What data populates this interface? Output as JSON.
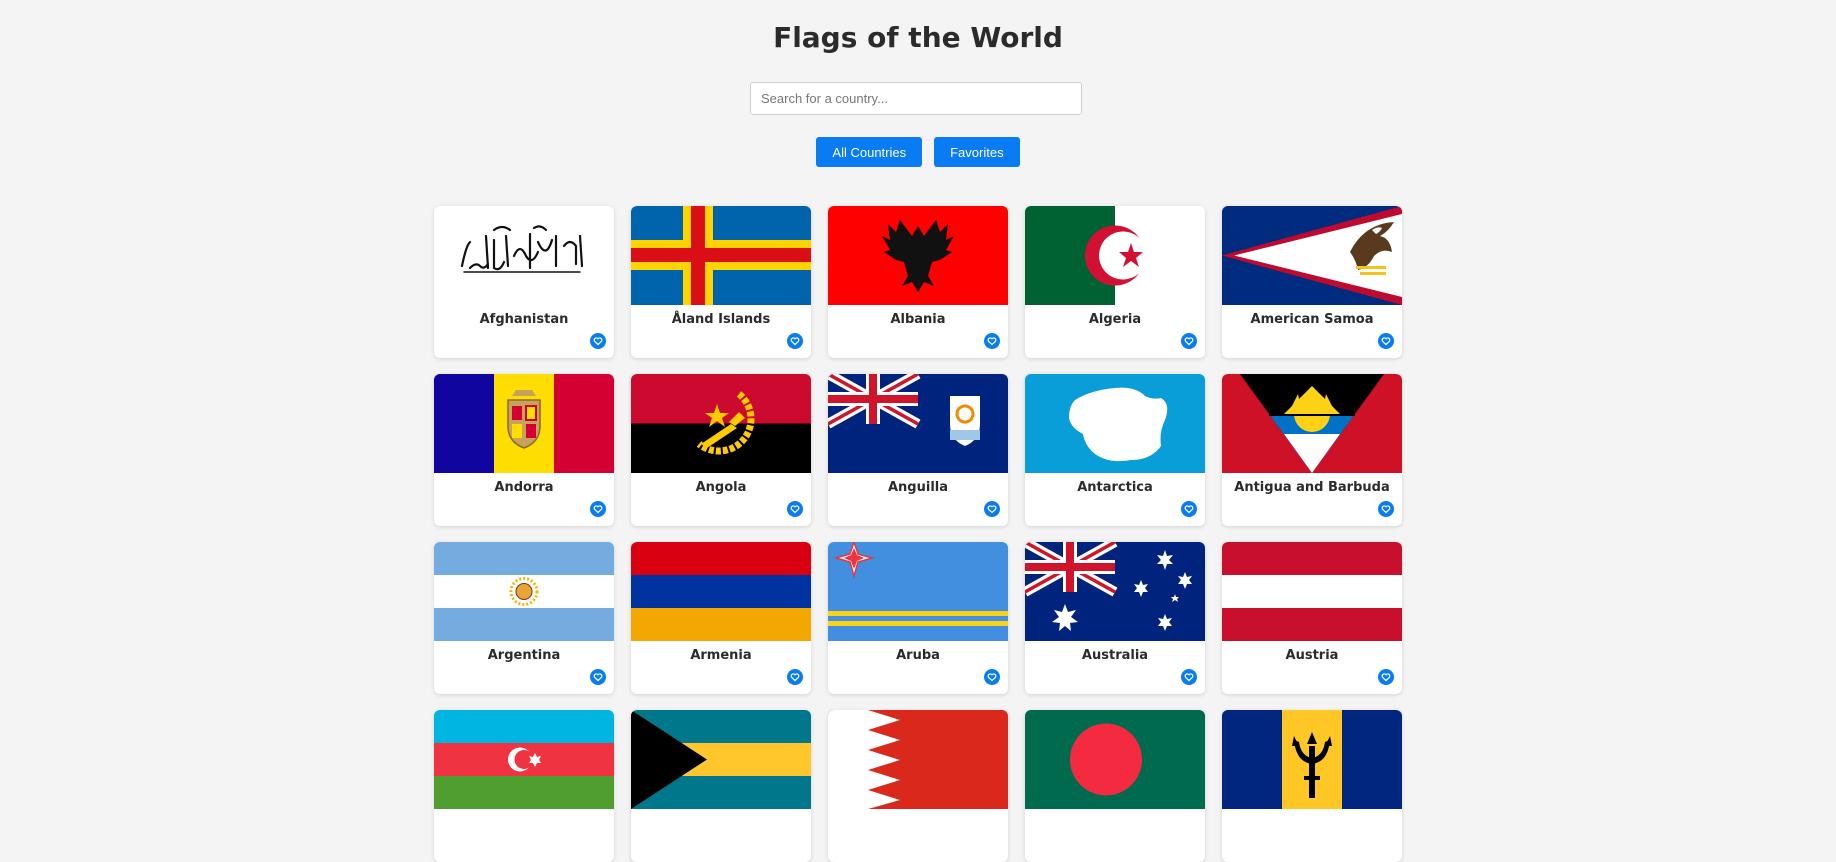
{
  "header": {
    "title": "Flags of the World"
  },
  "search": {
    "placeholder": "Search for a country..."
  },
  "tabs": [
    {
      "label": "All Countries"
    },
    {
      "label": "Favorites"
    }
  ],
  "countries": [
    {
      "name": "Afghanistan",
      "flag": "afghanistan-flag"
    },
    {
      "name": "Åland Islands",
      "flag": "aland-islands-flag"
    },
    {
      "name": "Albania",
      "flag": "albania-flag"
    },
    {
      "name": "Algeria",
      "flag": "algeria-flag"
    },
    {
      "name": "American Samoa",
      "flag": "american-samoa-flag"
    },
    {
      "name": "Andorra",
      "flag": "andorra-flag"
    },
    {
      "name": "Angola",
      "flag": "angola-flag"
    },
    {
      "name": "Anguilla",
      "flag": "anguilla-flag"
    },
    {
      "name": "Antarctica",
      "flag": "antarctica-flag"
    },
    {
      "name": "Antigua and Barbuda",
      "flag": "antigua-and-barbuda-flag"
    },
    {
      "name": "Argentina",
      "flag": "argentina-flag"
    },
    {
      "name": "Armenia",
      "flag": "armenia-flag"
    },
    {
      "name": "Aruba",
      "flag": "aruba-flag"
    },
    {
      "name": "Australia",
      "flag": "australia-flag"
    },
    {
      "name": "Austria",
      "flag": "austria-flag"
    },
    {
      "name": "",
      "flag": "azerbaijan-flag"
    },
    {
      "name": "",
      "flag": "bahamas-flag"
    },
    {
      "name": "",
      "flag": "bahrain-flag"
    },
    {
      "name": "",
      "flag": "bangladesh-flag"
    },
    {
      "name": "",
      "flag": "barbados-flag"
    }
  ],
  "favorite_icon": "heart-icon",
  "colors": {
    "accent": "#0a7cf3",
    "background": "#f4f4f4",
    "card": "#ffffff"
  }
}
